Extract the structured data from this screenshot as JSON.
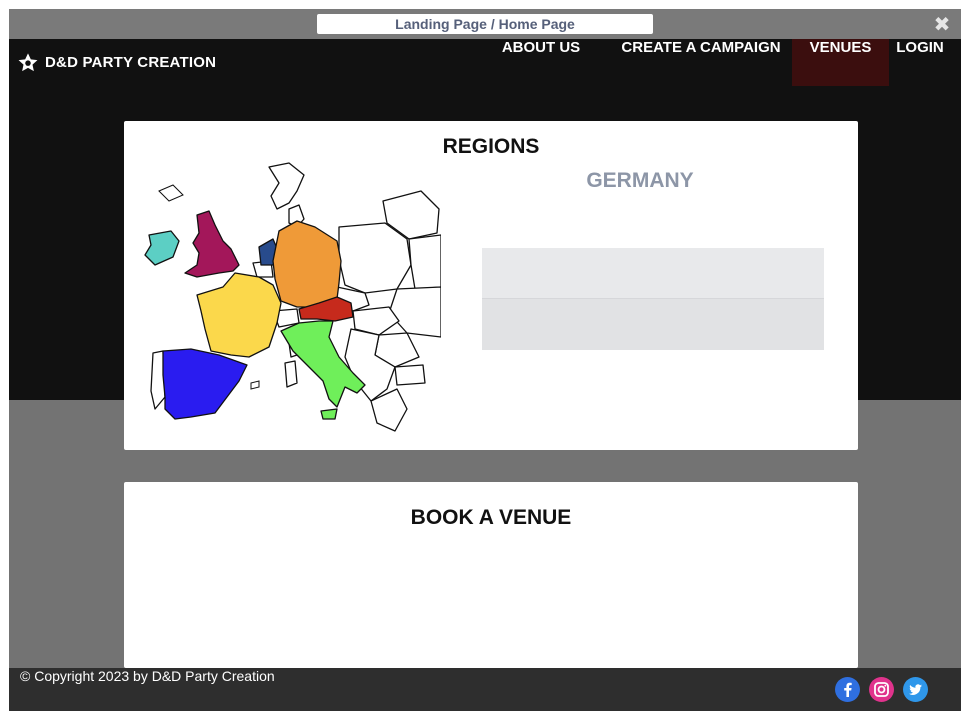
{
  "window": {
    "title": "Landing Page / Home Page",
    "close_glyph": "✖"
  },
  "navbar": {
    "brand": "D&D PARTY CREATION",
    "brand_icon": "star-icon",
    "items": [
      {
        "label": "ABOUT US",
        "active": false
      },
      {
        "label": "CREATE A CAMPAIGN",
        "active": false
      },
      {
        "label": "VENUES",
        "active": true
      },
      {
        "label": "LOGIN",
        "active": false
      }
    ]
  },
  "regions": {
    "title": "REGIONS",
    "selected_region": "GERMANY",
    "map_regions": [
      {
        "name": "Ireland",
        "color": "#5ccfc4"
      },
      {
        "name": "United Kingdom",
        "color": "#a3175a"
      },
      {
        "name": "Netherlands",
        "color": "#284b8c"
      },
      {
        "name": "Germany",
        "color": "#ef9a38"
      },
      {
        "name": "France",
        "color": "#fbd84b"
      },
      {
        "name": "Austria",
        "color": "#c62a1c"
      },
      {
        "name": "Italy",
        "color": "#6fef5a"
      },
      {
        "name": "Spain",
        "color": "#2a1cf0"
      }
    ]
  },
  "booking": {
    "title": "BOOK A VENUE"
  },
  "footer": {
    "copyright": "© Copyright 2023 by D&D Party Creation",
    "social": [
      "facebook-icon",
      "instagram-icon",
      "twitter-icon"
    ]
  },
  "colors": {
    "navbar_bg": "#111111",
    "active_nav_bg": "#3b0e0e",
    "page_bg": "#737373",
    "footer_bg": "#2e2e2e",
    "region_name_text": "#8d96a7"
  }
}
